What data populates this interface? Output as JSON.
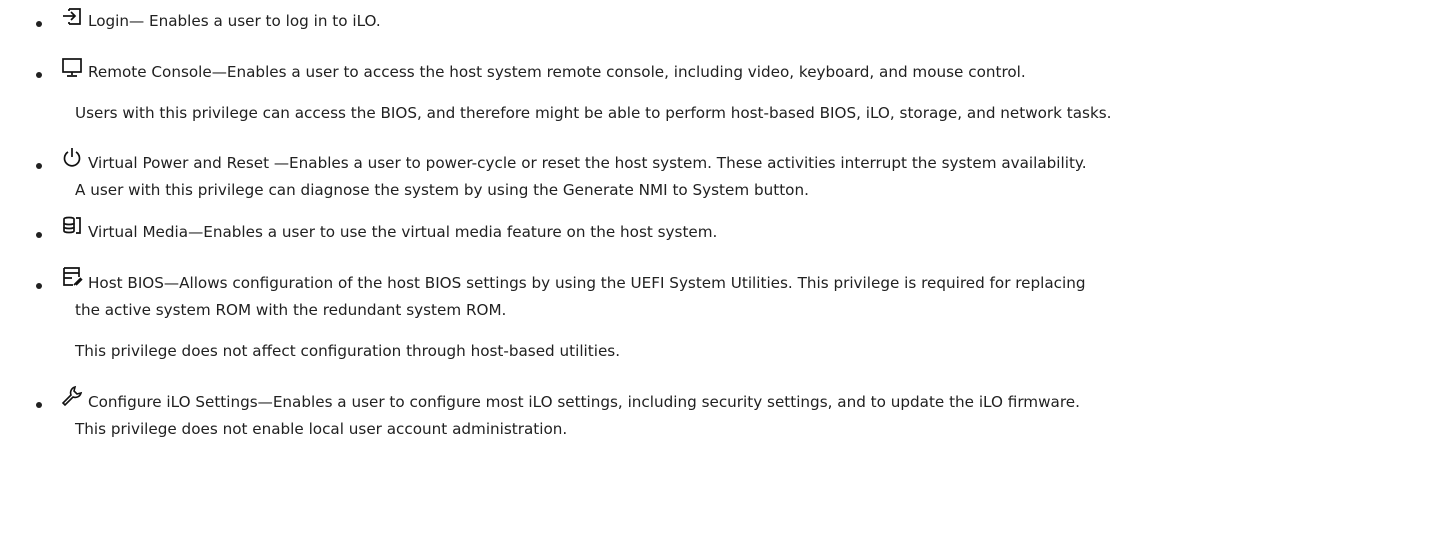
{
  "items": [
    {
      "icon": "login-icon",
      "lines": [
        "Login— Enables a user to log in to  iLO."
      ]
    },
    {
      "icon": "monitor-icon",
      "lines": [
        "Remote Console—Enables a user to access the host system remote console, including video, keyboard, and mouse control."
      ],
      "note": "Users with this privilege can access the BIOS, and therefore might be able to perform host-based BIOS,   iLO, storage, and network tasks."
    },
    {
      "icon": "power-icon",
      "lines": [
        "Virtual Power and Reset —Enables a user to power-cycle or reset the host system. These activities interrupt the system availability.",
        "A user with this privilege can diagnose the system by using the Generate NMI to System button."
      ]
    },
    {
      "icon": "virtual-media-icon",
      "lines": [
        "Virtual Media—Enables a user to use the virtual media feature on the host system."
      ]
    },
    {
      "icon": "host-bios-icon",
      "lines": [
        "Host BIOS—Allows configuration of the host BIOS settings by using the   UEFI System Utilities. This privilege is required for replacing",
        "the active system ROM with the redundant system ROM."
      ],
      "note": "This privilege does not affect configuration through host-based utilities."
    },
    {
      "icon": "wrench-icon",
      "lines": [
        "Configure iLO Settings—Enables a user to configure most  iLO settings, including security settings, and to update the  iLO firmware.",
        "This privilege does not enable local user account administration."
      ]
    }
  ]
}
